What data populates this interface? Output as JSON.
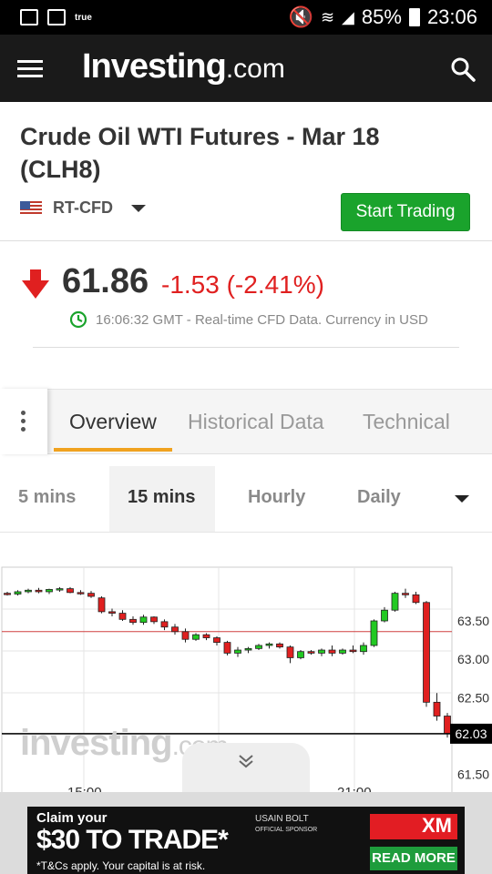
{
  "status_bar": {
    "carrier_text": "true",
    "battery": "85%",
    "time": "23:06"
  },
  "header": {
    "logo_main": "Investing",
    "logo_suffix": ".com"
  },
  "instrument": {
    "title": "Crude Oil WTI Futures - Mar 18 (CLH8)",
    "exchange": "RT-CFD",
    "trade_button": "Start Trading",
    "price": "61.86",
    "change": "-1.53 (-2.41%)",
    "timestamp": "16:06:32 GMT - Real-time CFD Data. Currency in USD",
    "direction": "down",
    "down_color": "#e02020"
  },
  "tabs": [
    {
      "label": "Overview",
      "active": true
    },
    {
      "label": "Historical Data",
      "active": false
    },
    {
      "label": "Technical",
      "active": false
    }
  ],
  "timeframes": [
    {
      "label": "5 mins",
      "active": false
    },
    {
      "label": "15 mins",
      "active": true
    },
    {
      "label": "Hourly",
      "active": false
    },
    {
      "label": "Daily",
      "active": false
    }
  ],
  "chart_data": {
    "type": "candlestick",
    "y_ticks": [
      "63.50",
      "63.00",
      "62.50",
      "61.50"
    ],
    "x_ticks": [
      "15:00",
      "21:00"
    ],
    "current_price_label": "62.03",
    "watermark": "investing.com",
    "ylim": [
      61.4,
      64.2
    ],
    "up_color": "#22c922",
    "down_color": "#e02020",
    "candles": [
      [
        63.86,
        63.88,
        63.83,
        63.85
      ],
      [
        63.85,
        63.9,
        63.83,
        63.88
      ],
      [
        63.88,
        63.92,
        63.86,
        63.9
      ],
      [
        63.9,
        63.93,
        63.86,
        63.88
      ],
      [
        63.88,
        63.92,
        63.85,
        63.91
      ],
      [
        63.91,
        63.94,
        63.88,
        63.92
      ],
      [
        63.92,
        63.94,
        63.86,
        63.87
      ],
      [
        63.87,
        63.9,
        63.84,
        63.86
      ],
      [
        63.86,
        63.89,
        63.8,
        63.82
      ],
      [
        63.8,
        63.82,
        63.6,
        63.62
      ],
      [
        63.62,
        63.66,
        63.56,
        63.6
      ],
      [
        63.6,
        63.64,
        63.5,
        63.52
      ],
      [
        63.52,
        63.56,
        63.45,
        63.48
      ],
      [
        63.48,
        63.58,
        63.45,
        63.55
      ],
      [
        63.55,
        63.56,
        63.46,
        63.49
      ],
      [
        63.49,
        63.52,
        63.38,
        63.42
      ],
      [
        63.42,
        63.46,
        63.32,
        63.36
      ],
      [
        63.36,
        63.4,
        63.22,
        63.26
      ],
      [
        63.26,
        63.34,
        63.24,
        63.32
      ],
      [
        63.32,
        63.34,
        63.25,
        63.28
      ],
      [
        63.28,
        63.3,
        63.18,
        63.22
      ],
      [
        63.22,
        63.24,
        63.05,
        63.08
      ],
      [
        63.08,
        63.16,
        63.03,
        63.12
      ],
      [
        63.12,
        63.16,
        63.08,
        63.14
      ],
      [
        63.14,
        63.2,
        63.12,
        63.18
      ],
      [
        63.18,
        63.22,
        63.14,
        63.2
      ],
      [
        63.2,
        63.22,
        63.14,
        63.16
      ],
      [
        63.16,
        63.18,
        62.95,
        63.02
      ],
      [
        63.02,
        63.12,
        63.0,
        63.1
      ],
      [
        63.1,
        63.12,
        63.06,
        63.08
      ],
      [
        63.08,
        63.14,
        63.04,
        63.12
      ],
      [
        63.12,
        63.18,
        63.04,
        63.08
      ],
      [
        63.08,
        63.14,
        63.06,
        63.12
      ],
      [
        63.12,
        63.18,
        63.08,
        63.1
      ],
      [
        63.1,
        63.22,
        63.06,
        63.18
      ],
      [
        63.18,
        63.52,
        63.16,
        63.5
      ],
      [
        63.5,
        63.68,
        63.48,
        63.64
      ],
      [
        63.64,
        63.88,
        63.62,
        63.86
      ],
      [
        63.86,
        63.92,
        63.8,
        63.84
      ],
      [
        63.84,
        63.88,
        63.72,
        63.74
      ],
      [
        63.74,
        63.76,
        62.38,
        62.44
      ],
      [
        62.44,
        62.56,
        62.2,
        62.26
      ],
      [
        62.26,
        62.3,
        61.98,
        62.03
      ]
    ],
    "ref_line": 63.36
  },
  "ad": {
    "claim": "Claim your",
    "amount": "$30 TO TRADE*",
    "terms": "*T&Cs apply. Your capital is at risk.",
    "sponsor": "USAIN BOLT",
    "sponsor_sub": "OFFICIAL SPONSOR",
    "brand": "XM",
    "cta": "READ MORE"
  }
}
